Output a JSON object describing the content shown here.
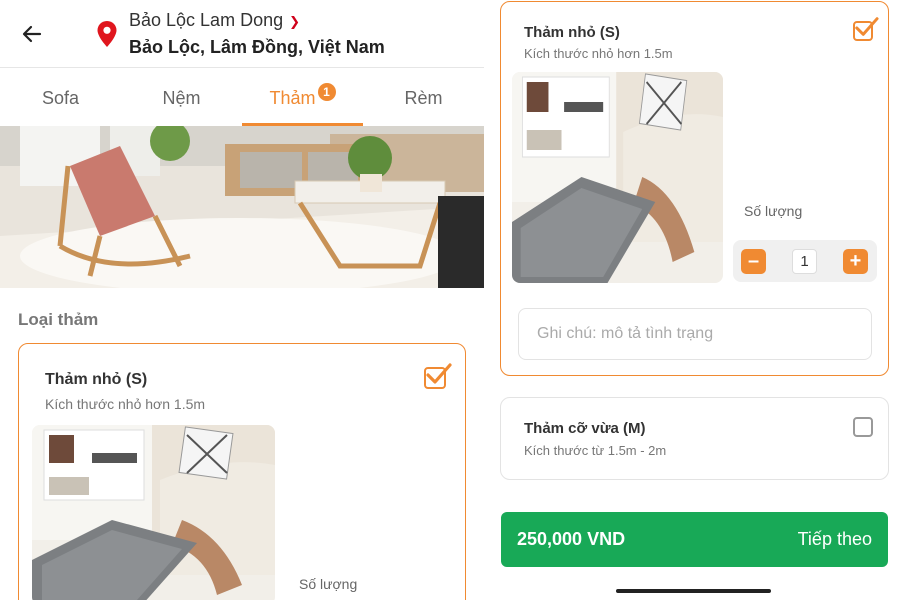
{
  "header": {
    "location_primary": "Bảo Lộc Lam Dong",
    "location_secondary": "Bảo Lộc, Lâm Đồng, Việt Nam"
  },
  "tabs": [
    {
      "label": "Sofa",
      "active": false
    },
    {
      "label": "Nệm",
      "active": false
    },
    {
      "label": "Thảm",
      "active": true,
      "badge": "1"
    },
    {
      "label": "Rèm",
      "active": false
    }
  ],
  "section": {
    "title": "Loại thảm"
  },
  "cards": [
    {
      "title": "Thảm nhỏ (S)",
      "subtitle": "Kích thước nhỏ hơn 1.5m",
      "checked": true,
      "quantity_label": "Số lượng",
      "quantity": "1"
    },
    {
      "title": "Thảm cỡ vừa (M)",
      "subtitle": "Kích thước từ 1.5m - 2m",
      "checked": false
    }
  ],
  "note": {
    "placeholder": "Ghi chú: mô tả tình trạng"
  },
  "footer": {
    "price": "250,000 VND",
    "next_label": "Tiếp theo"
  },
  "colors": {
    "accent": "#f08a32",
    "cta": "#18a957",
    "pin": "#e0161e"
  }
}
